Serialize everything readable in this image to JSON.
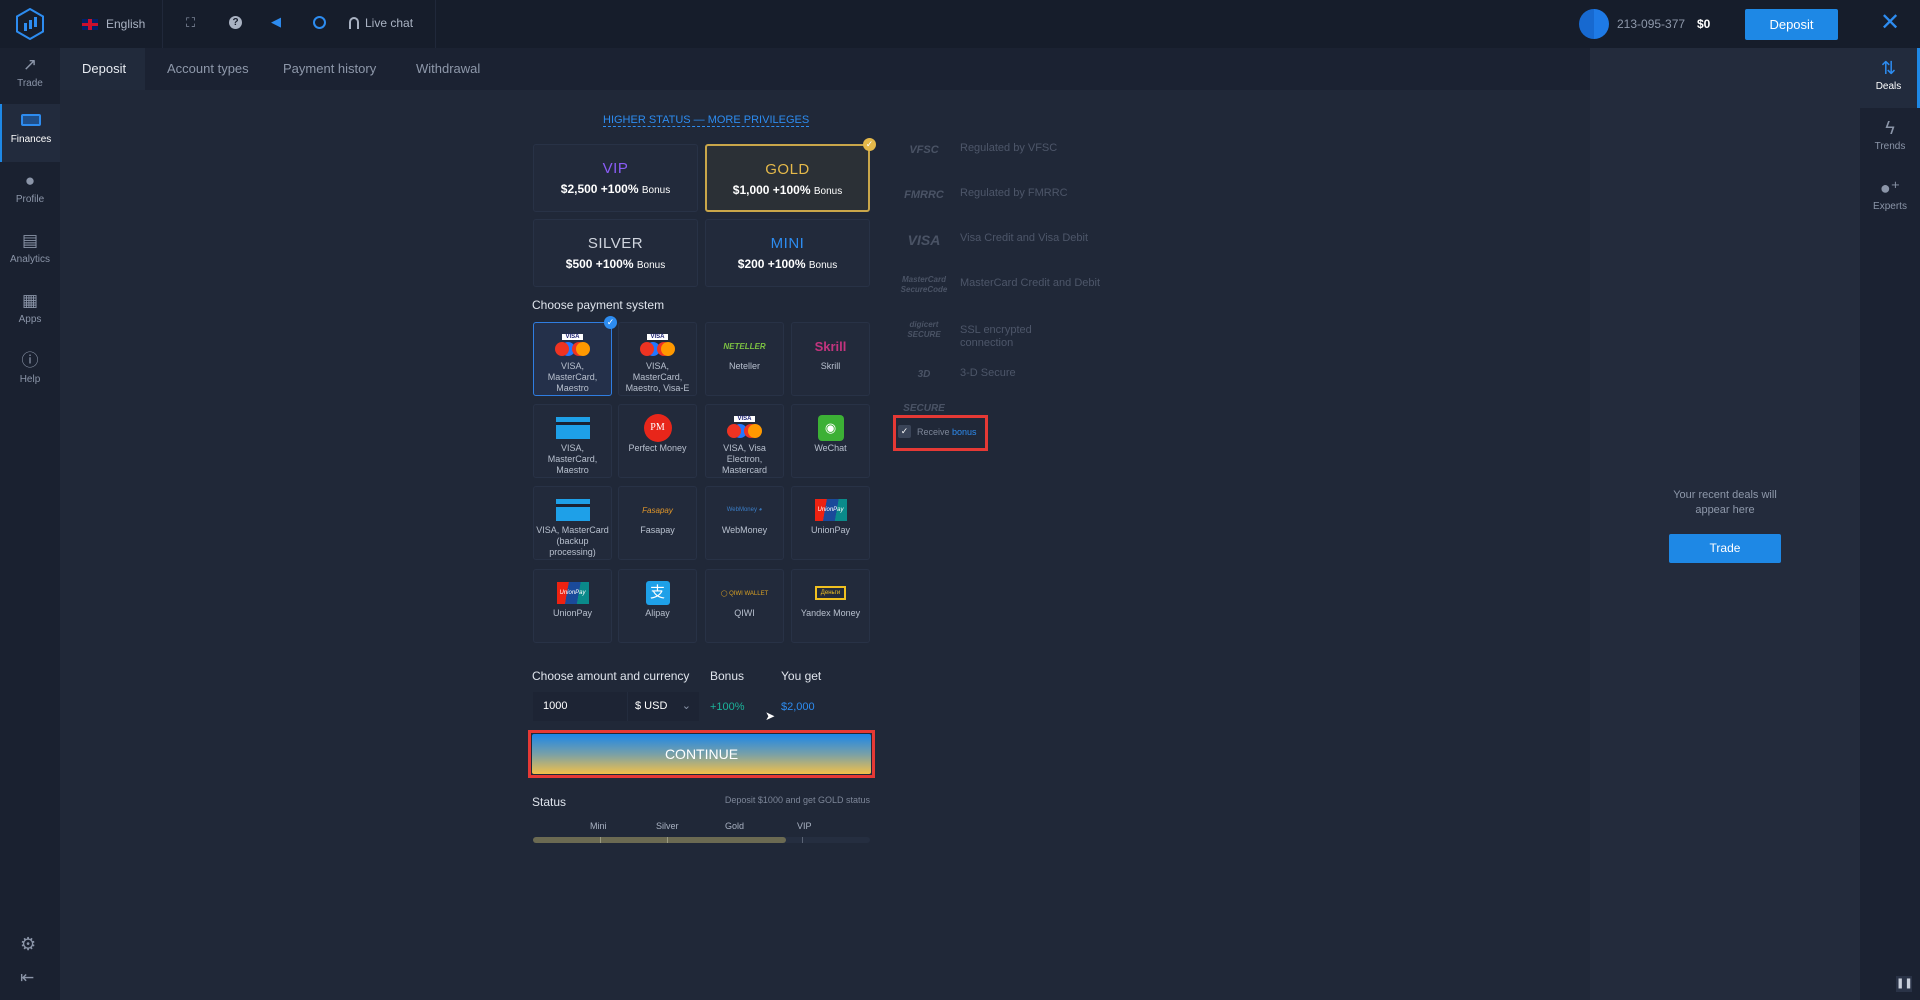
{
  "topbar": {
    "language": "English",
    "live_chat": "Live chat",
    "account_id": "213-095-377",
    "balance": "$0",
    "deposit_label": "Deposit",
    "icons": [
      "logo-icon",
      "uk-flag-icon",
      "fullscreen-icon",
      "help-icon",
      "sound-icon",
      "settings-target-icon",
      "headset-icon",
      "close-icon"
    ]
  },
  "sidebar": {
    "items": [
      {
        "label": "Trade"
      },
      {
        "label": "Finances"
      },
      {
        "label": "Profile"
      },
      {
        "label": "Analytics"
      },
      {
        "label": "Apps"
      },
      {
        "label": "Help"
      }
    ]
  },
  "tabs": [
    {
      "label": "Deposit"
    },
    {
      "label": "Account types"
    },
    {
      "label": "Payment history"
    },
    {
      "label": "Withdrawal"
    }
  ],
  "main": {
    "privileges_link": "HIGHER STATUS — MORE PRIVILEGES",
    "statuses": [
      {
        "name": "VIP",
        "amount": "$2,500 +100%",
        "bonus": "Bonus",
        "color": "#8a5cf6"
      },
      {
        "name": "GOLD",
        "amount": "$1,000 +100%",
        "bonus": "Bonus",
        "color": "#e5b94a",
        "selected": true
      },
      {
        "name": "SILVER",
        "amount": "$500 +100%",
        "bonus": "Bonus",
        "color": "#d0d5de"
      },
      {
        "name": "MINI",
        "amount": "$200 +100%",
        "bonus": "Bonus",
        "color": "#2d8cf0"
      }
    ],
    "payment_heading": "Choose payment system",
    "payments": [
      {
        "label": "VISA, MasterCard, Maestro",
        "selected": true
      },
      {
        "label": "VISA, MasterCard, Maestro, Visa-E"
      },
      {
        "label": "Neteller",
        "logo": "NETELLER"
      },
      {
        "label": "Skrill",
        "logo": "Skrill"
      },
      {
        "label": "VISA, MasterCard, Maestro"
      },
      {
        "label": "Perfect Money",
        "logo": "PM"
      },
      {
        "label": "VISA, Visa Electron, Mastercard"
      },
      {
        "label": "WeChat"
      },
      {
        "label": "VISA, MasterCard (backup processing)"
      },
      {
        "label": "Fasapay",
        "logo": "Fasapay"
      },
      {
        "label": "WebMoney",
        "logo": "WebMoney"
      },
      {
        "label": "UnionPay",
        "logo": "UnionPay"
      },
      {
        "label": "UnionPay",
        "logo": "UnionPay"
      },
      {
        "label": "Alipay",
        "logo": "支"
      },
      {
        "label": "QIWI",
        "logo": "QIWI WALLET"
      },
      {
        "label": "Yandex Money",
        "logo": "Деньги"
      }
    ],
    "amount_heading": "Choose amount and currency",
    "bonus_heading": "Bonus",
    "youget_heading": "You get",
    "amount_value": "1000",
    "currency": "$ USD",
    "bonus_value": "+100%",
    "youget_value": "$2,000",
    "continue_label": "CONTINUE",
    "status_label": "Status",
    "status_hint": "Deposit $1000 and get GOLD status",
    "status_levels": [
      "Mini",
      "Silver",
      "Gold",
      "VIP"
    ],
    "status_progress_percent": 75
  },
  "trust": [
    {
      "logo": "VFSC",
      "text": "Regulated by VFSC"
    },
    {
      "logo": "FMRRC",
      "text": "Regulated by FMRRC"
    },
    {
      "logo": "VISA",
      "text": "Visa Credit and Visa Debit"
    },
    {
      "logo": "MasterCard SecureCode",
      "text": "MasterCard Credit and Debit"
    },
    {
      "logo": "digicert SECURE",
      "text": "SSL encrypted connection"
    },
    {
      "logo": "3D SECURE",
      "text": "3-D Secure"
    }
  ],
  "receive_bonus": {
    "label": "Receive",
    "link": "bonus",
    "checked": true
  },
  "right_panel": {
    "empty_text": "Your recent deals will appear here",
    "trade_label": "Trade"
  },
  "rail": {
    "items": [
      {
        "label": "Deals"
      },
      {
        "label": "Trends"
      },
      {
        "label": "Experts"
      }
    ]
  },
  "colors": {
    "accent": "#1e88e5",
    "gold": "#e5b94a",
    "highlight": "#e53935"
  }
}
